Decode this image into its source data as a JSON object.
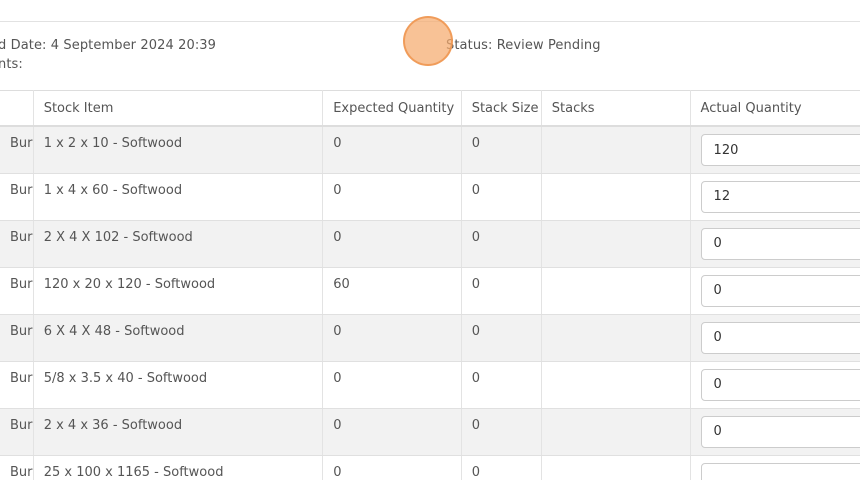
{
  "header": {
    "created_date": "d Date: 4 September 2024 20:39",
    "comments": "nts:",
    "status": "Status: Review Pending"
  },
  "table": {
    "columns": [
      "",
      "Stock Item",
      "Expected Quantity",
      "Stack Size",
      "Stacks",
      "Actual Quantity"
    ],
    "rows": [
      {
        "name": "Burch",
        "item": "1 x 2 x 10 - Softwood",
        "expected": "0",
        "stack_size": "0",
        "stacks": "",
        "actual": "120"
      },
      {
        "name": "Burch",
        "item": "1 x 4 x 60 - Softwood",
        "expected": "0",
        "stack_size": "0",
        "stacks": "",
        "actual": "12"
      },
      {
        "name": "Burch",
        "item": "2 X 4 X 102 - Softwood",
        "expected": "0",
        "stack_size": "0",
        "stacks": "",
        "actual": "0"
      },
      {
        "name": "Burch",
        "item": "120 x 20 x 120 - Softwood",
        "expected": "60",
        "stack_size": "0",
        "stacks": "",
        "actual": "0"
      },
      {
        "name": "Burch",
        "item": "6 X 4 X 48 - Softwood",
        "expected": "0",
        "stack_size": "0",
        "stacks": "",
        "actual": "0"
      },
      {
        "name": "Burch",
        "item": "5/8 x 3.5 x 40 - Softwood",
        "expected": "0",
        "stack_size": "0",
        "stacks": "",
        "actual": "0"
      },
      {
        "name": "Burch",
        "item": "2 x 4 x 36 - Softwood",
        "expected": "0",
        "stack_size": "0",
        "stacks": "",
        "actual": "0"
      },
      {
        "name": "Burch",
        "item": "25 x 100 x 1165 - Softwood",
        "expected": "0",
        "stack_size": "0",
        "stacks": "",
        "actual": ""
      }
    ]
  },
  "colors": {
    "row_stripe": "#f2f2f2",
    "border": "#dddddd",
    "text": "#555555",
    "click_marker": "#f5aa6e"
  }
}
